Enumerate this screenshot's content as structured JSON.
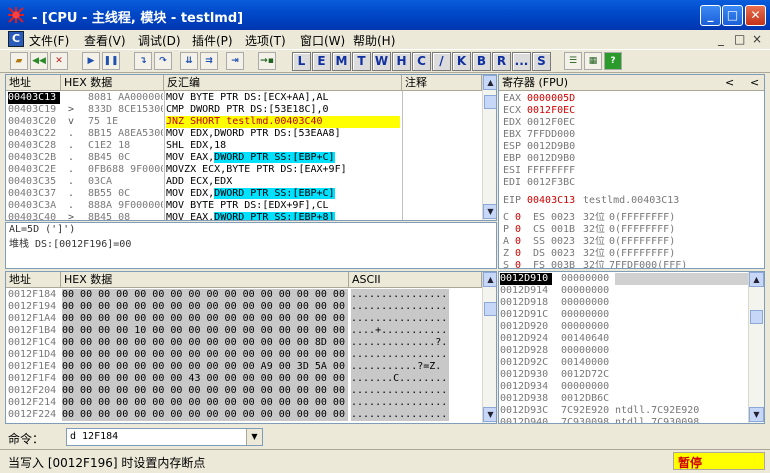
{
  "window": {
    "title": "- [CPU - 主线程, 模块 - testlmd]",
    "minimize": "_",
    "restore": "□",
    "close": "✕"
  },
  "menu": [
    "文件(F)",
    "查看(V)",
    "调试(D)",
    "插件(P)",
    "选项(T)",
    "窗口(W)",
    "帮助(H)"
  ],
  "menu_right": [
    "_",
    "□",
    "×"
  ],
  "letters": [
    "L",
    "E",
    "M",
    "T",
    "W",
    "H",
    "C",
    "/",
    "K",
    "B",
    "R",
    "...",
    "S"
  ],
  "disasm": {
    "headers": [
      "地址",
      "HEX 数据",
      "反汇编",
      "注释"
    ],
    "rows": [
      {
        "addr": "00403C13",
        "arrow": "",
        "hex": "8081 AA000000",
        "code": "MOV BYTE PTR DS:[ECX+AA],AL",
        "sel": true
      },
      {
        "addr": "00403C19",
        "arrow": ">",
        "hex": "833D 8CE15300",
        "code": "CMP DWORD PTR DS:[53E18C],0"
      },
      {
        "addr": "00403C20",
        "arrow": "v",
        "hex": "75 1E",
        "code": "JNZ SHORT testlmd.00403C40",
        "jump": true
      },
      {
        "addr": "00403C22",
        "arrow": ".",
        "hex": "8B15 A8EA5300",
        "code": "MOV EDX,DWORD PTR DS:[53EAA8]"
      },
      {
        "addr": "00403C28",
        "arrow": ".",
        "hex": "C1E2 18",
        "code": "SHL EDX,18"
      },
      {
        "addr": "00403C2B",
        "arrow": ".",
        "hex": "8B45 0C",
        "code": "MOV EAX,DWORD PTR SS:[EBP+C]",
        "hl": "DWORD PTR SS:[EBP+C]"
      },
      {
        "addr": "00403C2E",
        "arrow": ".",
        "hex": "0FB688 9F0000",
        "code": "MOVZX ECX,BYTE PTR DS:[EAX+9F]"
      },
      {
        "addr": "00403C35",
        "arrow": ".",
        "hex": "03CA",
        "code": "ADD ECX,EDX"
      },
      {
        "addr": "00403C37",
        "arrow": ".",
        "hex": "8B55 0C",
        "code": "MOV EDX,DWORD PTR SS:[EBP+C]",
        "hl": "DWORD PTR SS:[EBP+C]"
      },
      {
        "addr": "00403C3A",
        "arrow": ".",
        "hex": "888A 9F000000",
        "code": "MOV BYTE PTR DS:[EDX+9F],CL"
      },
      {
        "addr": "00403C40",
        "arrow": ">",
        "hex": "8B45 08",
        "code": "MOV EAX,DWORD PTR SS:[EBP+8]",
        "hl": "DWORD PTR SS:[EBP+8]"
      }
    ]
  },
  "info": {
    "line1": "AL=5D (']')",
    "line2": "堆栈 DS:[0012F196]=00"
  },
  "registers": {
    "header": "寄存器 (FPU)",
    "rows": [
      {
        "name": "EAX",
        "val": "0000005D",
        "red": true
      },
      {
        "name": "ECX",
        "val": "0012F0EC",
        "red": true
      },
      {
        "name": "EDX",
        "val": "0012F0EC"
      },
      {
        "name": "EBX",
        "val": "7FFDD000"
      },
      {
        "name": "ESP",
        "val": "0012D9B0"
      },
      {
        "name": "EBP",
        "val": "0012D9B0"
      },
      {
        "name": "ESI",
        "val": "FFFFFFFF"
      },
      {
        "name": "EDI",
        "val": "0012F3BC"
      }
    ],
    "eip": {
      "name": "EIP",
      "val": "00403C13",
      "comment": "testlmd.00403C13"
    },
    "flags": [
      {
        "f": "C",
        "v": "0",
        "seg": "ES",
        "sel": "0023",
        "bits": "32位",
        "base": "0(FFFFFFFF)"
      },
      {
        "f": "P",
        "v": "0",
        "seg": "CS",
        "sel": "001B",
        "bits": "32位",
        "base": "0(FFFFFFFF)"
      },
      {
        "f": "A",
        "v": "0",
        "seg": "SS",
        "sel": "0023",
        "bits": "32位",
        "base": "0(FFFFFFFF)"
      },
      {
        "f": "Z",
        "v": "0",
        "seg": "DS",
        "sel": "0023",
        "bits": "32位",
        "base": "0(FFFFFFFF)"
      },
      {
        "f": "S",
        "v": "0",
        "seg": "FS",
        "sel": "003B",
        "bits": "32位",
        "base": "7FFDF000(FFF)"
      }
    ]
  },
  "dump": {
    "headers": [
      "地址",
      "HEX 数据",
      "ASCII"
    ],
    "rows": [
      {
        "addr": "0012F184",
        "hex": "00 00 00 00 00 00 00 00 00 00 00 00 00 00 00 00",
        "ascii": "................",
        "sel": true
      },
      {
        "addr": "0012F194",
        "hex": "00 00 00 00 00 00 00 00 00 00 00 00 00 00 00 00",
        "ascii": "................"
      },
      {
        "addr": "0012F1A4",
        "hex": "00 00 00 00 00 00 00 00 00 00 00 00 00 00 00 00",
        "ascii": "................"
      },
      {
        "addr": "0012F1B4",
        "hex": "00 00 00 00 10 00 00 00 00 00 00 00 00 00 00 00",
        "ascii": "....+..........."
      },
      {
        "addr": "0012F1C4",
        "hex": "00 00 00 00 00 00 00 00 00 00 00 00 00 00 8D 00",
        "ascii": "..............?."
      },
      {
        "addr": "0012F1D4",
        "hex": "00 00 00 00 00 00 00 00 00 00 00 00 00 00 00 00",
        "ascii": "................"
      },
      {
        "addr": "0012F1E4",
        "hex": "00 00 00 00 00 00 00 00 00 00 00 A9 00 3D 5A 00",
        "ascii": "...........?=Z."
      },
      {
        "addr": "0012F1F4",
        "hex": "00 00 00 00 00 00 00 43 00 00 00 00 00 00 00 00",
        "ascii": ".......C........"
      },
      {
        "addr": "0012F204",
        "hex": "00 00 00 00 00 00 00 00 00 00 00 00 00 00 00 00",
        "ascii": "................"
      },
      {
        "addr": "0012F214",
        "hex": "00 00 00 00 00 00 00 00 00 00 00 00 00 00 00 00",
        "ascii": "................"
      },
      {
        "addr": "0012F224",
        "hex": "00 00 00 00 00 00 00 00 00 00 00 00 00 00 00 00",
        "ascii": "................"
      }
    ]
  },
  "stack": {
    "rows": [
      {
        "addr": "0012D910",
        "val": "00000000",
        "sel": true
      },
      {
        "addr": "0012D914",
        "val": "00000000"
      },
      {
        "addr": "0012D918",
        "val": "00000000"
      },
      {
        "addr": "0012D91C",
        "val": "00000000"
      },
      {
        "addr": "0012D920",
        "val": "00000000"
      },
      {
        "addr": "0012D924",
        "val": "00140640"
      },
      {
        "addr": "0012D928",
        "val": "00000000"
      },
      {
        "addr": "0012D92C",
        "val": "00140000"
      },
      {
        "addr": "0012D930",
        "val": "0012D72C"
      },
      {
        "addr": "0012D934",
        "val": "00000000"
      },
      {
        "addr": "0012D938",
        "val": "0012DB6C"
      },
      {
        "addr": "0012D93C",
        "val": "7C92E920",
        "comment": "ntdll.7C92E920"
      },
      {
        "addr": "0012D940",
        "val": "7C930098",
        "comment": "ntdll.7C930098"
      }
    ]
  },
  "command": {
    "label": "命令：",
    "value": "d 12F184"
  },
  "status": {
    "text": "当写入 [0012F196] 时设置内存断点",
    "state": "暂停",
    "state_color": "#ffff00"
  }
}
